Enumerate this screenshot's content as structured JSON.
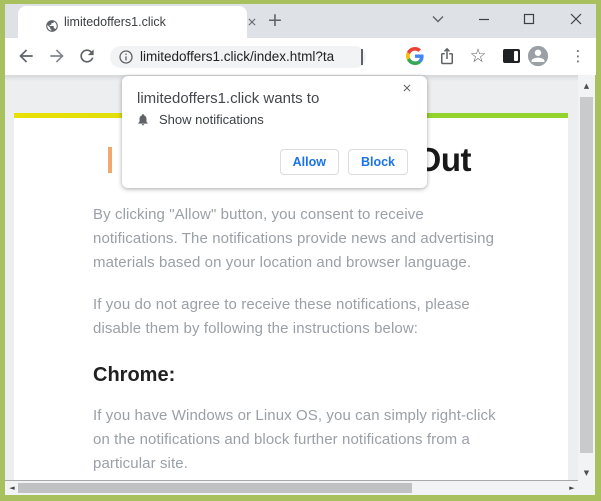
{
  "window": {
    "title_bar": {
      "tab_title": "limitedoffers1.click"
    }
  },
  "toolbar": {
    "url": "limitedoffers1.click/index.html?ta"
  },
  "dialog": {
    "title": "limitedoffers1.click wants to",
    "permission_label": "Show notifications",
    "allow_label": "Allow",
    "block_label": "Block"
  },
  "page": {
    "heading_visible_text": "Out",
    "paragraph1_lines": [
      "By clicking \"Allow\" button, you consent to receive",
      "notifications. The notifications provide news and advertising",
      "materials based on your location and browser language."
    ],
    "paragraph2_lines": [
      "If you do not agree to receive these notifications, please",
      "disable them by following the instructions below:"
    ],
    "section_heading": "Chrome:",
    "paragraph3_lines": [
      "If you have Windows or Linux OS, you can simply right-click",
      "on the notifications and block further notifications from a",
      "particular site."
    ]
  },
  "icons": {
    "plus": "+",
    "menu_dots": "⋮",
    "star": "☆",
    "scroll_up": "▲",
    "scroll_down": "▼",
    "scroll_left": "◄",
    "scroll_right": "►"
  },
  "colors": {
    "window_border_green": "#a8c15e",
    "accent_line_yellow": "#e9e104",
    "accent_line_green": "#92d32d",
    "button_text_blue": "#1a73e8",
    "body_text_gray": "#9aa0a6",
    "titlebar_gray": "#dee1e6"
  }
}
